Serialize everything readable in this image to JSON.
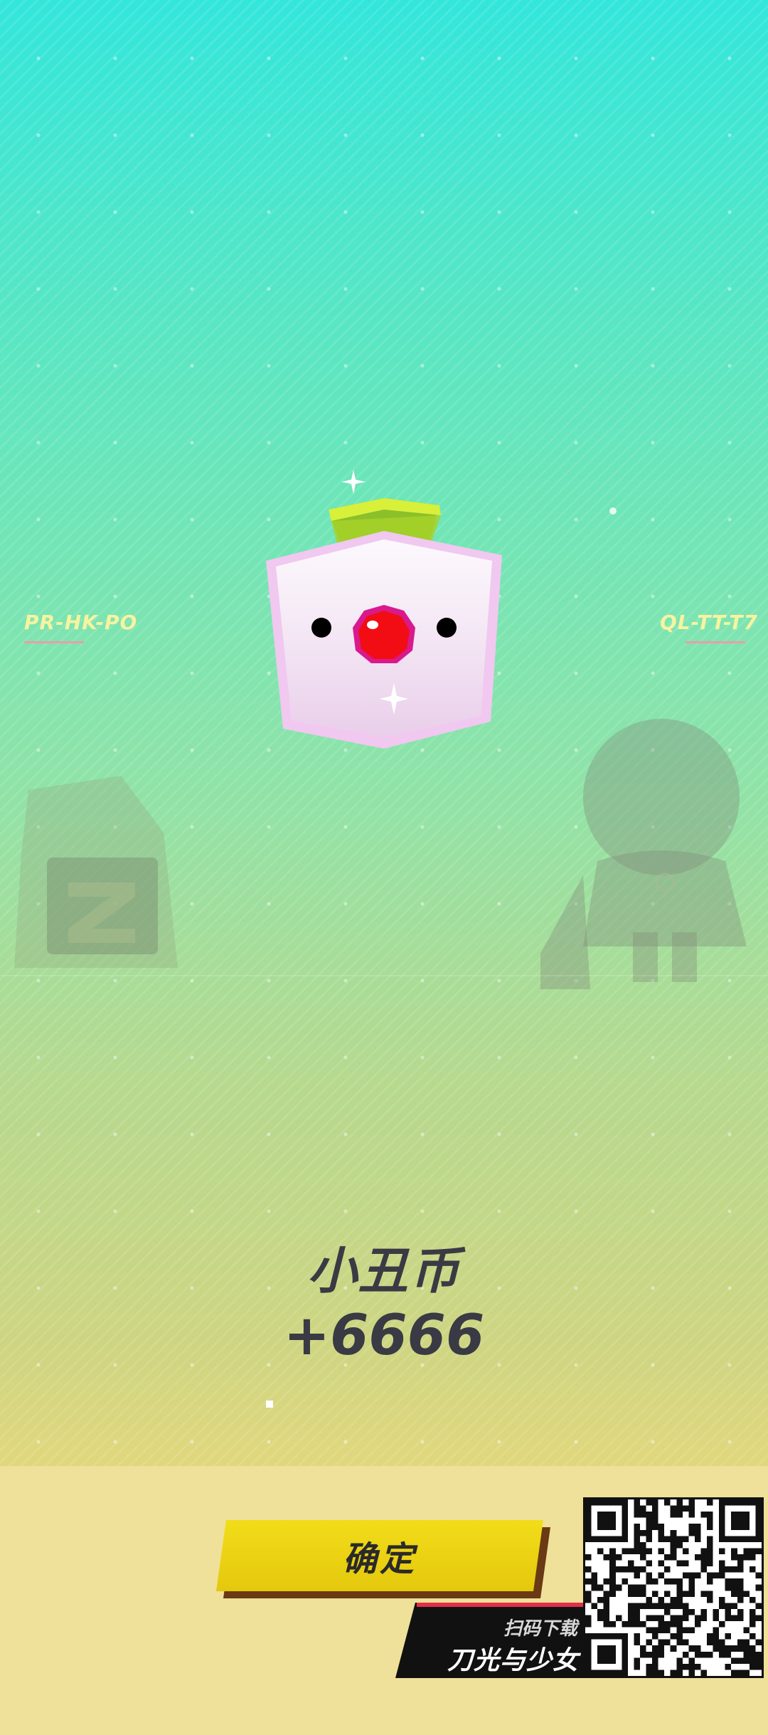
{
  "side_codes": {
    "left": "PR-HK-PO",
    "right": "QL-TT-T7"
  },
  "reward": {
    "icon": "clown-coin-icon",
    "name": "小丑币",
    "amount": "+6666"
  },
  "confirm_button": {
    "label": "确定"
  },
  "download_badge": {
    "scan_text": "扫码下载",
    "game_title": "刀光与少女"
  },
  "qr_code": {
    "icon": "qr-code-icon"
  },
  "colors": {
    "bg_top": "#33e6db",
    "bg_bottom": "#e0d77d",
    "bottom_band": "#efe09a",
    "button_yellow": "#e9cf10",
    "button_shadow": "#6a3a14",
    "text_dark": "#3a3a44",
    "side_code_text": "#f7f3a0",
    "badge_accent": "#e2304a"
  }
}
